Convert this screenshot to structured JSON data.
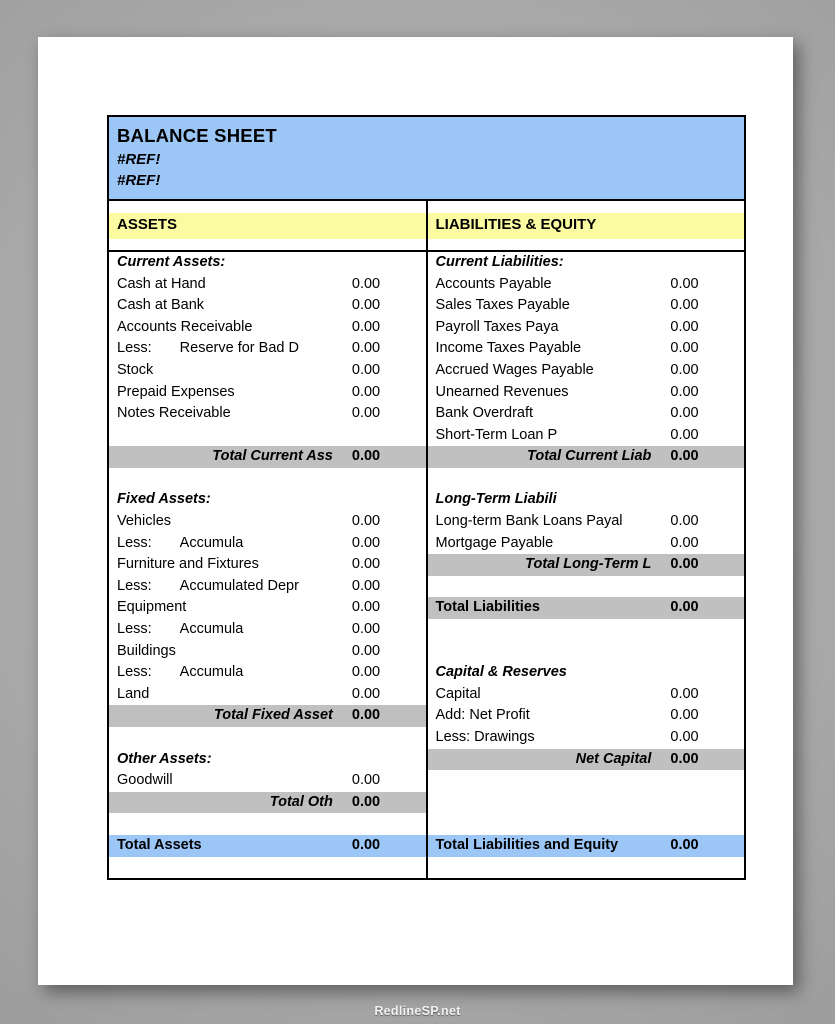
{
  "document": {
    "title": "BALANCE SHEET",
    "subtitle_line_1": "#REF!",
    "subtitle_line_2": "#REF!",
    "watermark": "RedlineSP.net"
  },
  "colors": {
    "header_blue": "#9CC6F6",
    "section_yellow": "#FBFBA2",
    "total_gray": "#C0C0C0",
    "paper_white": "#FFFFFF",
    "border_black": "#000000"
  },
  "assets": {
    "header": "ASSETS",
    "current": {
      "heading": "Current Assets:",
      "items": [
        {
          "label": "Cash at Hand",
          "value": "0.00"
        },
        {
          "label": "Cash at Bank",
          "value": "0.00"
        },
        {
          "label": "Accounts Receivable",
          "value": "0.00"
        },
        {
          "label": "Less:",
          "sublabel": "Reserve for Bad D",
          "value": "0.00"
        },
        {
          "label": "Stock",
          "value": "0.00"
        },
        {
          "label": "Prepaid Expenses",
          "value": "0.00"
        },
        {
          "label": "Notes Receivable",
          "value": "0.00"
        }
      ],
      "total": {
        "label": "Total Current Ass",
        "value": "0.00"
      }
    },
    "fixed": {
      "heading": "Fixed Assets:",
      "items": [
        {
          "label": "Vehicles",
          "value": "0.00"
        },
        {
          "label": "Less:",
          "sublabel": "Accumula",
          "value": "0.00"
        },
        {
          "label": "Furniture and Fixtures",
          "value": "0.00"
        },
        {
          "label": "Less:",
          "sublabel": "Accumulated Depr",
          "value": "0.00"
        },
        {
          "label": "Equipment",
          "value": "0.00"
        },
        {
          "label": "Less:",
          "sublabel": "Accumula",
          "value": "0.00"
        },
        {
          "label": "Buildings",
          "value": "0.00"
        },
        {
          "label": "Less:",
          "sublabel": "Accumula",
          "value": "0.00"
        },
        {
          "label": "Land",
          "value": "0.00"
        }
      ],
      "total": {
        "label": "Total Fixed Asset",
        "value": "0.00"
      }
    },
    "other": {
      "heading": "Other Assets:",
      "items": [
        {
          "label": "Goodwill",
          "value": "0.00"
        }
      ],
      "total": {
        "label": "Total Oth",
        "value": "0.00"
      }
    },
    "grand_total": {
      "label": "Total Assets",
      "value": "0.00"
    }
  },
  "liabilities": {
    "header": "LIABILITIES & EQUITY",
    "current": {
      "heading": "Current Liabilities:",
      "items": [
        {
          "label": "Accounts Payable",
          "value": "0.00"
        },
        {
          "label": "Sales Taxes Payable",
          "value": "0.00"
        },
        {
          "label": "Payroll Taxes Paya",
          "value": "0.00"
        },
        {
          "label": "Income Taxes Payable",
          "value": "0.00"
        },
        {
          "label": "Accrued Wages Payable",
          "value": "0.00"
        },
        {
          "label": "Unearned Revenues",
          "value": "0.00"
        },
        {
          "label": "Bank Overdraft",
          "value": "0.00"
        },
        {
          "label": "Short-Term Loan P",
          "value": "0.00"
        }
      ],
      "total": {
        "label": "Total Current Liab",
        "value": "0.00"
      }
    },
    "long_term": {
      "heading": "Long-Term Liabili",
      "items": [
        {
          "label": "Long-term Bank Loans Payal",
          "value": "0.00"
        },
        {
          "label": "Mortgage Payable",
          "value": "0.00"
        }
      ],
      "total": {
        "label": "Total Long-Term L",
        "value": "0.00"
      }
    },
    "total_liabilities": {
      "label": "Total Liabilities",
      "value": "0.00"
    },
    "capital": {
      "heading": "Capital & Reserves",
      "items": [
        {
          "label": "Capital",
          "value": "0.00"
        },
        {
          "label": "Add: Net Profit",
          "value": "0.00"
        },
        {
          "label": "Less: Drawings",
          "value": "0.00"
        }
      ],
      "total": {
        "label": "Net Capital",
        "value": "0.00"
      }
    },
    "grand_total": {
      "label": "Total Liabilities and Equity",
      "value": "0.00"
    }
  }
}
